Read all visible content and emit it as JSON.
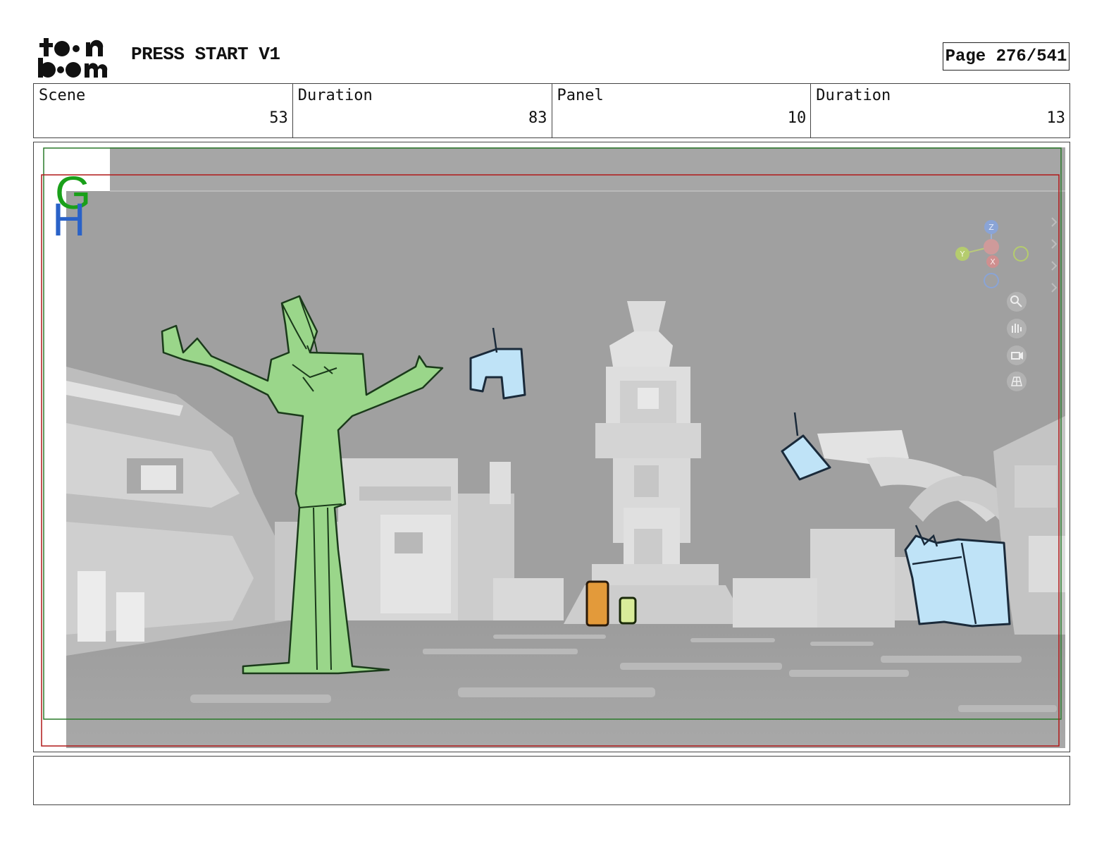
{
  "header": {
    "logo_text": "toon boom",
    "project_title": "PRESS START V1",
    "page_label": "Page 276/541"
  },
  "info": [
    {
      "label": "Scene",
      "value": "53"
    },
    {
      "label": "Duration",
      "value": "83"
    },
    {
      "label": "Panel",
      "value": "10"
    },
    {
      "label": "Duration",
      "value": "13"
    }
  ],
  "panel": {
    "markers": [
      "G",
      "H"
    ],
    "gizmo_axes": [
      "Z",
      "Y",
      "X"
    ],
    "viewport_tools": [
      "zoom-icon",
      "hand-icon",
      "camera-icon",
      "grid-icon"
    ],
    "colors": {
      "safe_frame": "#2a7a2a",
      "camera_frame": "#b01818",
      "tree_character": "#9ad68a",
      "cube_characters": "#bfe3f7",
      "marker_g": "#1aa01a",
      "marker_h": "#2a62c8"
    }
  },
  "notes": {
    "text": ""
  }
}
